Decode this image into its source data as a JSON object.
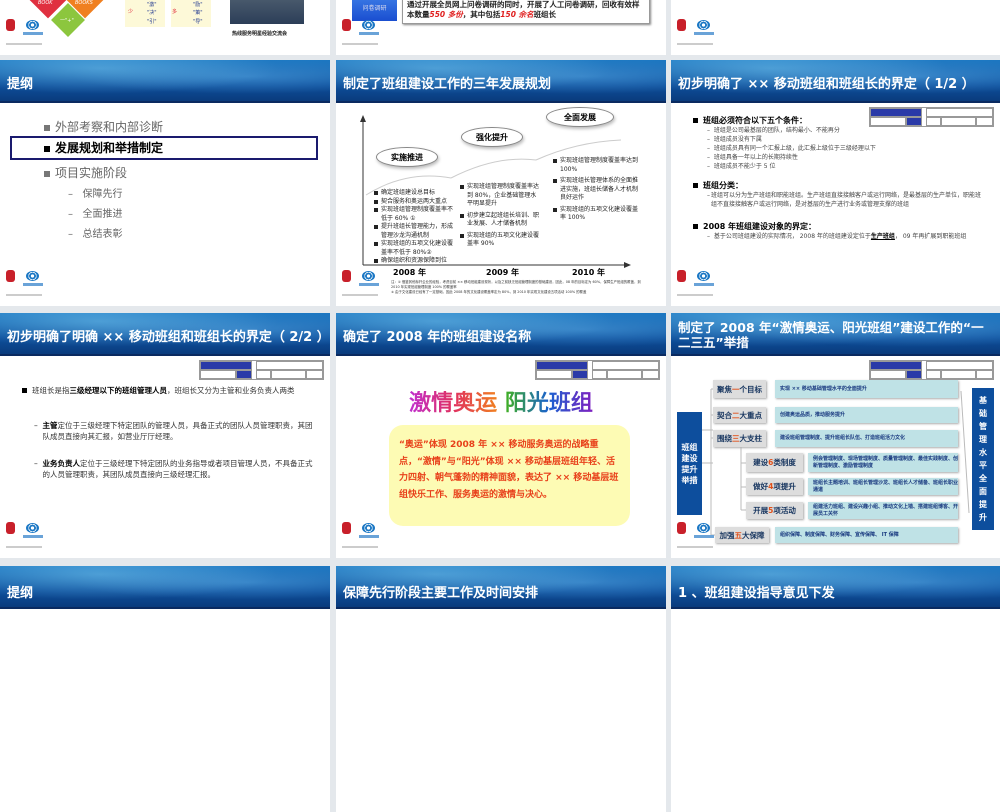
{
  "top_row": {
    "slide1": {
      "diamond1": "BOOK",
      "diamond2": "BOOKS",
      "diamond3": "一\"+\"",
      "col_a_head": "少",
      "col_a": [
        "\"激\"",
        "\"决\"",
        "\"引\""
      ],
      "col_b_head": "多",
      "col_b": [
        "\"励\"",
        "\"策\"",
        "\"导\""
      ],
      "photo_caption": "热线服务明星经验交流会"
    },
    "slide2": {
      "button": "问卷调研",
      "text_a": "通过开展全员网上问卷调研的同时，开展了人工问卷调研，回收有效样本数量",
      "num1": "550 多份",
      "text_b": "，其中包括",
      "num2": "150 余名",
      "text_c": "班组长"
    }
  },
  "slides": {
    "outline": {
      "title": "提纲",
      "items": [
        "外部考察和内部诊断",
        "发展规划和举措制定",
        "项目实施阶段"
      ],
      "sub": [
        "保障先行",
        "全面推进",
        "总结表彰"
      ]
    },
    "plan": {
      "title": "制定了班组建设工作的三年发展规划",
      "phases": [
        "实施推进",
        "强化提升",
        "全面发展"
      ],
      "years": [
        "2008 年",
        "2009 年",
        "2010 年"
      ],
      "col2008": [
        "确定班组建设总目标",
        "契合服务和奥运两大重点",
        "实现班组管理制度覆盖率不低于 60% ①",
        "提升班组长管理能力，形成管理沙龙沟通机制",
        "实现班组的五项文化建设覆盖率不低于 80%②",
        "确保组织和资源保障到位"
      ],
      "col2009": [
        "实现班组管理制度覆盖率达到 80%，企业基础管理水平明显提升",
        "初步建立起班组长培训、职业发展、人才储备机制",
        "实现班组的五项文化建设覆盖率 90%"
      ],
      "col2010": [
        "实现班组管理制度覆盖率达到 100%",
        "实现班组长管理体系的全面推进实施，班组长储备人才机制良好运作",
        "实现班组的五项文化建设覆盖率 100%"
      ],
      "note1": "注：① 借鉴其他标杆企业的经验，考虑目前 ×× 移动班组建设现状，以及之前缺乏班组管理制度的基础建设，因此，08 年的目标定为 60%，保障生产班组的覆盖，到 2010 年实现班组管理制度 100% 的覆盖率",
      "note2": "② 由于文化建设已经有了一定基础，因此 2008 年的文化建设覆盖率定为 80%，到 2010 年实现文化建设五项活动 100% 的覆盖"
    },
    "def1": {
      "title": "初步明确了 ×× 移动班组和班组长的界定（ 1/2 ）",
      "h1": "班组必须符合以下五个条件：",
      "h1_items": [
        "班组是公司最基层的团队，结构最小、不能再分",
        "班组成员没有下属",
        "班组成员具有同一个汇报上级，此汇报上级位于三级经理以下",
        "班组具备一年以上的长期持续性",
        "班组成员不能少于 5 位"
      ],
      "h2": "班组分类：",
      "h2_item": "班组可以分为生产班组和职能班组。生产班组直接接触客户或运行网络，是最基层的生产单位，职能班组不直接接触客户或运行网络，是对基层的生产进行业务或管理支撑的班组",
      "h3": "2008 年班组建设对象的界定：",
      "h3_a": "基于公司班组建设的实际情况， 2008 年的班组建设定位于",
      "h3_bold": "生产班组",
      "h3_b": "， 09 年再扩展到职能班组"
    },
    "def2": {
      "title": "初步明确了明确 ×× 移动班组和班组长的界定（ 2/2 ）",
      "p1_a": "班组长是指",
      "p1_bold": "三级经理以下的班组管理人员",
      "p1_b": "，班组长又分为主管和业务负责人两类",
      "p2_bold": "主管",
      "p2": "定位于三级经理下特定团队的管理人员，具备正式的团队人员管理职责，其团队成员直接向其汇报，如营业厅厅经理。",
      "p3_bold": "业务负责人",
      "p3": "定位于三级经理下特定团队的业务指导或者项目管理人员，不具备正式的人员管理职责，其团队成员直接向三级经理汇报。"
    },
    "name": {
      "title": "确定了 2008 年的班组建设名称",
      "slogan_a": "激情奥运",
      "slogan_b": "阳光班组",
      "box": "“奥运”体现 2008 年 ×× 移动服务奥运的战略重点，“激情”与“阳光”体现 ×× 移动基层班组年轻、活力四射、朝气蓬勃的精神面貌，表达了 ×× 移动基层班组快乐工作、服务奥运的激情与决心。"
    },
    "measures": {
      "title": "制定了 2008 年“激情奥运、阳光班组”建设工作的“一二三五”举措",
      "left": "班组建设提升举措",
      "right": "基础管理水平全面提升",
      "rows": [
        {
          "pre": "聚焦",
          "hl": "一",
          "post": "个目标",
          "content": "实现 ×× 移动基础管理水平的全面提升"
        },
        {
          "pre": "契合",
          "hl": "二",
          "post": "大重点",
          "content": "创建奥运品质，推动服务提升"
        },
        {
          "pre": "围绕",
          "hl": "三",
          "post": "大支柱",
          "content": "建设班组管理制度、提升班组长队伍、打造班组活力文化"
        },
        {
          "pre": "建设 ",
          "hl": "6",
          "post": " 类制度",
          "content": "例会管理制度、现场管理制度、质量管理制度、最佳实践制度、创新管理制度、激励管理制度"
        },
        {
          "pre": "做好 ",
          "hl": "4",
          "post": " 项提升",
          "content": "班组长主题培训、班组长管理沙龙、班组长人才储备、班组长职业通道"
        },
        {
          "pre": "开展 ",
          "hl": "5",
          "post": " 项活动",
          "content": "组建活力班组、建设兴趣小组、推动文化上墙、搭建班组博客、开展员工关怀"
        },
        {
          "pre": "加强",
          "hl": "五",
          "post": "大保障",
          "content": "组织保障、制度保障、财务保障、宣传保障、 IT 保障"
        }
      ]
    },
    "bottom": [
      "提纲",
      "保障先行阶段主要工作及时间安排",
      "1 、班组建设指导意见下发"
    ]
  }
}
